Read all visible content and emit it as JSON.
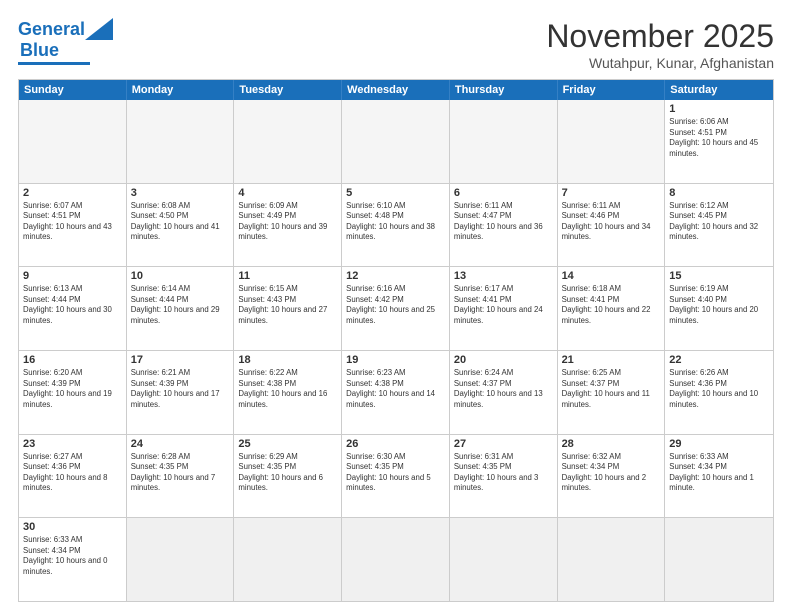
{
  "header": {
    "logo_text_1": "General",
    "logo_text_2": "Blue",
    "month": "November 2025",
    "location": "Wutahpur, Kunar, Afghanistan"
  },
  "calendar": {
    "days": [
      "Sunday",
      "Monday",
      "Tuesday",
      "Wednesday",
      "Thursday",
      "Friday",
      "Saturday"
    ],
    "rows": [
      [
        {
          "day": "",
          "info": ""
        },
        {
          "day": "",
          "info": ""
        },
        {
          "day": "",
          "info": ""
        },
        {
          "day": "",
          "info": ""
        },
        {
          "day": "",
          "info": ""
        },
        {
          "day": "",
          "info": ""
        },
        {
          "day": "1",
          "info": "Sunrise: 6:06 AM\nSunset: 4:51 PM\nDaylight: 10 hours and 45 minutes."
        }
      ],
      [
        {
          "day": "2",
          "info": "Sunrise: 6:07 AM\nSunset: 4:51 PM\nDaylight: 10 hours and 43 minutes."
        },
        {
          "day": "3",
          "info": "Sunrise: 6:08 AM\nSunset: 4:50 PM\nDaylight: 10 hours and 41 minutes."
        },
        {
          "day": "4",
          "info": "Sunrise: 6:09 AM\nSunset: 4:49 PM\nDaylight: 10 hours and 39 minutes."
        },
        {
          "day": "5",
          "info": "Sunrise: 6:10 AM\nSunset: 4:48 PM\nDaylight: 10 hours and 38 minutes."
        },
        {
          "day": "6",
          "info": "Sunrise: 6:11 AM\nSunset: 4:47 PM\nDaylight: 10 hours and 36 minutes."
        },
        {
          "day": "7",
          "info": "Sunrise: 6:11 AM\nSunset: 4:46 PM\nDaylight: 10 hours and 34 minutes."
        },
        {
          "day": "8",
          "info": "Sunrise: 6:12 AM\nSunset: 4:45 PM\nDaylight: 10 hours and 32 minutes."
        }
      ],
      [
        {
          "day": "9",
          "info": "Sunrise: 6:13 AM\nSunset: 4:44 PM\nDaylight: 10 hours and 30 minutes."
        },
        {
          "day": "10",
          "info": "Sunrise: 6:14 AM\nSunset: 4:44 PM\nDaylight: 10 hours and 29 minutes."
        },
        {
          "day": "11",
          "info": "Sunrise: 6:15 AM\nSunset: 4:43 PM\nDaylight: 10 hours and 27 minutes."
        },
        {
          "day": "12",
          "info": "Sunrise: 6:16 AM\nSunset: 4:42 PM\nDaylight: 10 hours and 25 minutes."
        },
        {
          "day": "13",
          "info": "Sunrise: 6:17 AM\nSunset: 4:41 PM\nDaylight: 10 hours and 24 minutes."
        },
        {
          "day": "14",
          "info": "Sunrise: 6:18 AM\nSunset: 4:41 PM\nDaylight: 10 hours and 22 minutes."
        },
        {
          "day": "15",
          "info": "Sunrise: 6:19 AM\nSunset: 4:40 PM\nDaylight: 10 hours and 20 minutes."
        }
      ],
      [
        {
          "day": "16",
          "info": "Sunrise: 6:20 AM\nSunset: 4:39 PM\nDaylight: 10 hours and 19 minutes."
        },
        {
          "day": "17",
          "info": "Sunrise: 6:21 AM\nSunset: 4:39 PM\nDaylight: 10 hours and 17 minutes."
        },
        {
          "day": "18",
          "info": "Sunrise: 6:22 AM\nSunset: 4:38 PM\nDaylight: 10 hours and 16 minutes."
        },
        {
          "day": "19",
          "info": "Sunrise: 6:23 AM\nSunset: 4:38 PM\nDaylight: 10 hours and 14 minutes."
        },
        {
          "day": "20",
          "info": "Sunrise: 6:24 AM\nSunset: 4:37 PM\nDaylight: 10 hours and 13 minutes."
        },
        {
          "day": "21",
          "info": "Sunrise: 6:25 AM\nSunset: 4:37 PM\nDaylight: 10 hours and 11 minutes."
        },
        {
          "day": "22",
          "info": "Sunrise: 6:26 AM\nSunset: 4:36 PM\nDaylight: 10 hours and 10 minutes."
        }
      ],
      [
        {
          "day": "23",
          "info": "Sunrise: 6:27 AM\nSunset: 4:36 PM\nDaylight: 10 hours and 8 minutes."
        },
        {
          "day": "24",
          "info": "Sunrise: 6:28 AM\nSunset: 4:35 PM\nDaylight: 10 hours and 7 minutes."
        },
        {
          "day": "25",
          "info": "Sunrise: 6:29 AM\nSunset: 4:35 PM\nDaylight: 10 hours and 6 minutes."
        },
        {
          "day": "26",
          "info": "Sunrise: 6:30 AM\nSunset: 4:35 PM\nDaylight: 10 hours and 5 minutes."
        },
        {
          "day": "27",
          "info": "Sunrise: 6:31 AM\nSunset: 4:35 PM\nDaylight: 10 hours and 3 minutes."
        },
        {
          "day": "28",
          "info": "Sunrise: 6:32 AM\nSunset: 4:34 PM\nDaylight: 10 hours and 2 minutes."
        },
        {
          "day": "29",
          "info": "Sunrise: 6:33 AM\nSunset: 4:34 PM\nDaylight: 10 hours and 1 minute."
        }
      ],
      [
        {
          "day": "30",
          "info": "Sunrise: 6:33 AM\nSunset: 4:34 PM\nDaylight: 10 hours and 0 minutes."
        },
        {
          "day": "",
          "info": ""
        },
        {
          "day": "",
          "info": ""
        },
        {
          "day": "",
          "info": ""
        },
        {
          "day": "",
          "info": ""
        },
        {
          "day": "",
          "info": ""
        },
        {
          "day": "",
          "info": ""
        }
      ]
    ]
  }
}
